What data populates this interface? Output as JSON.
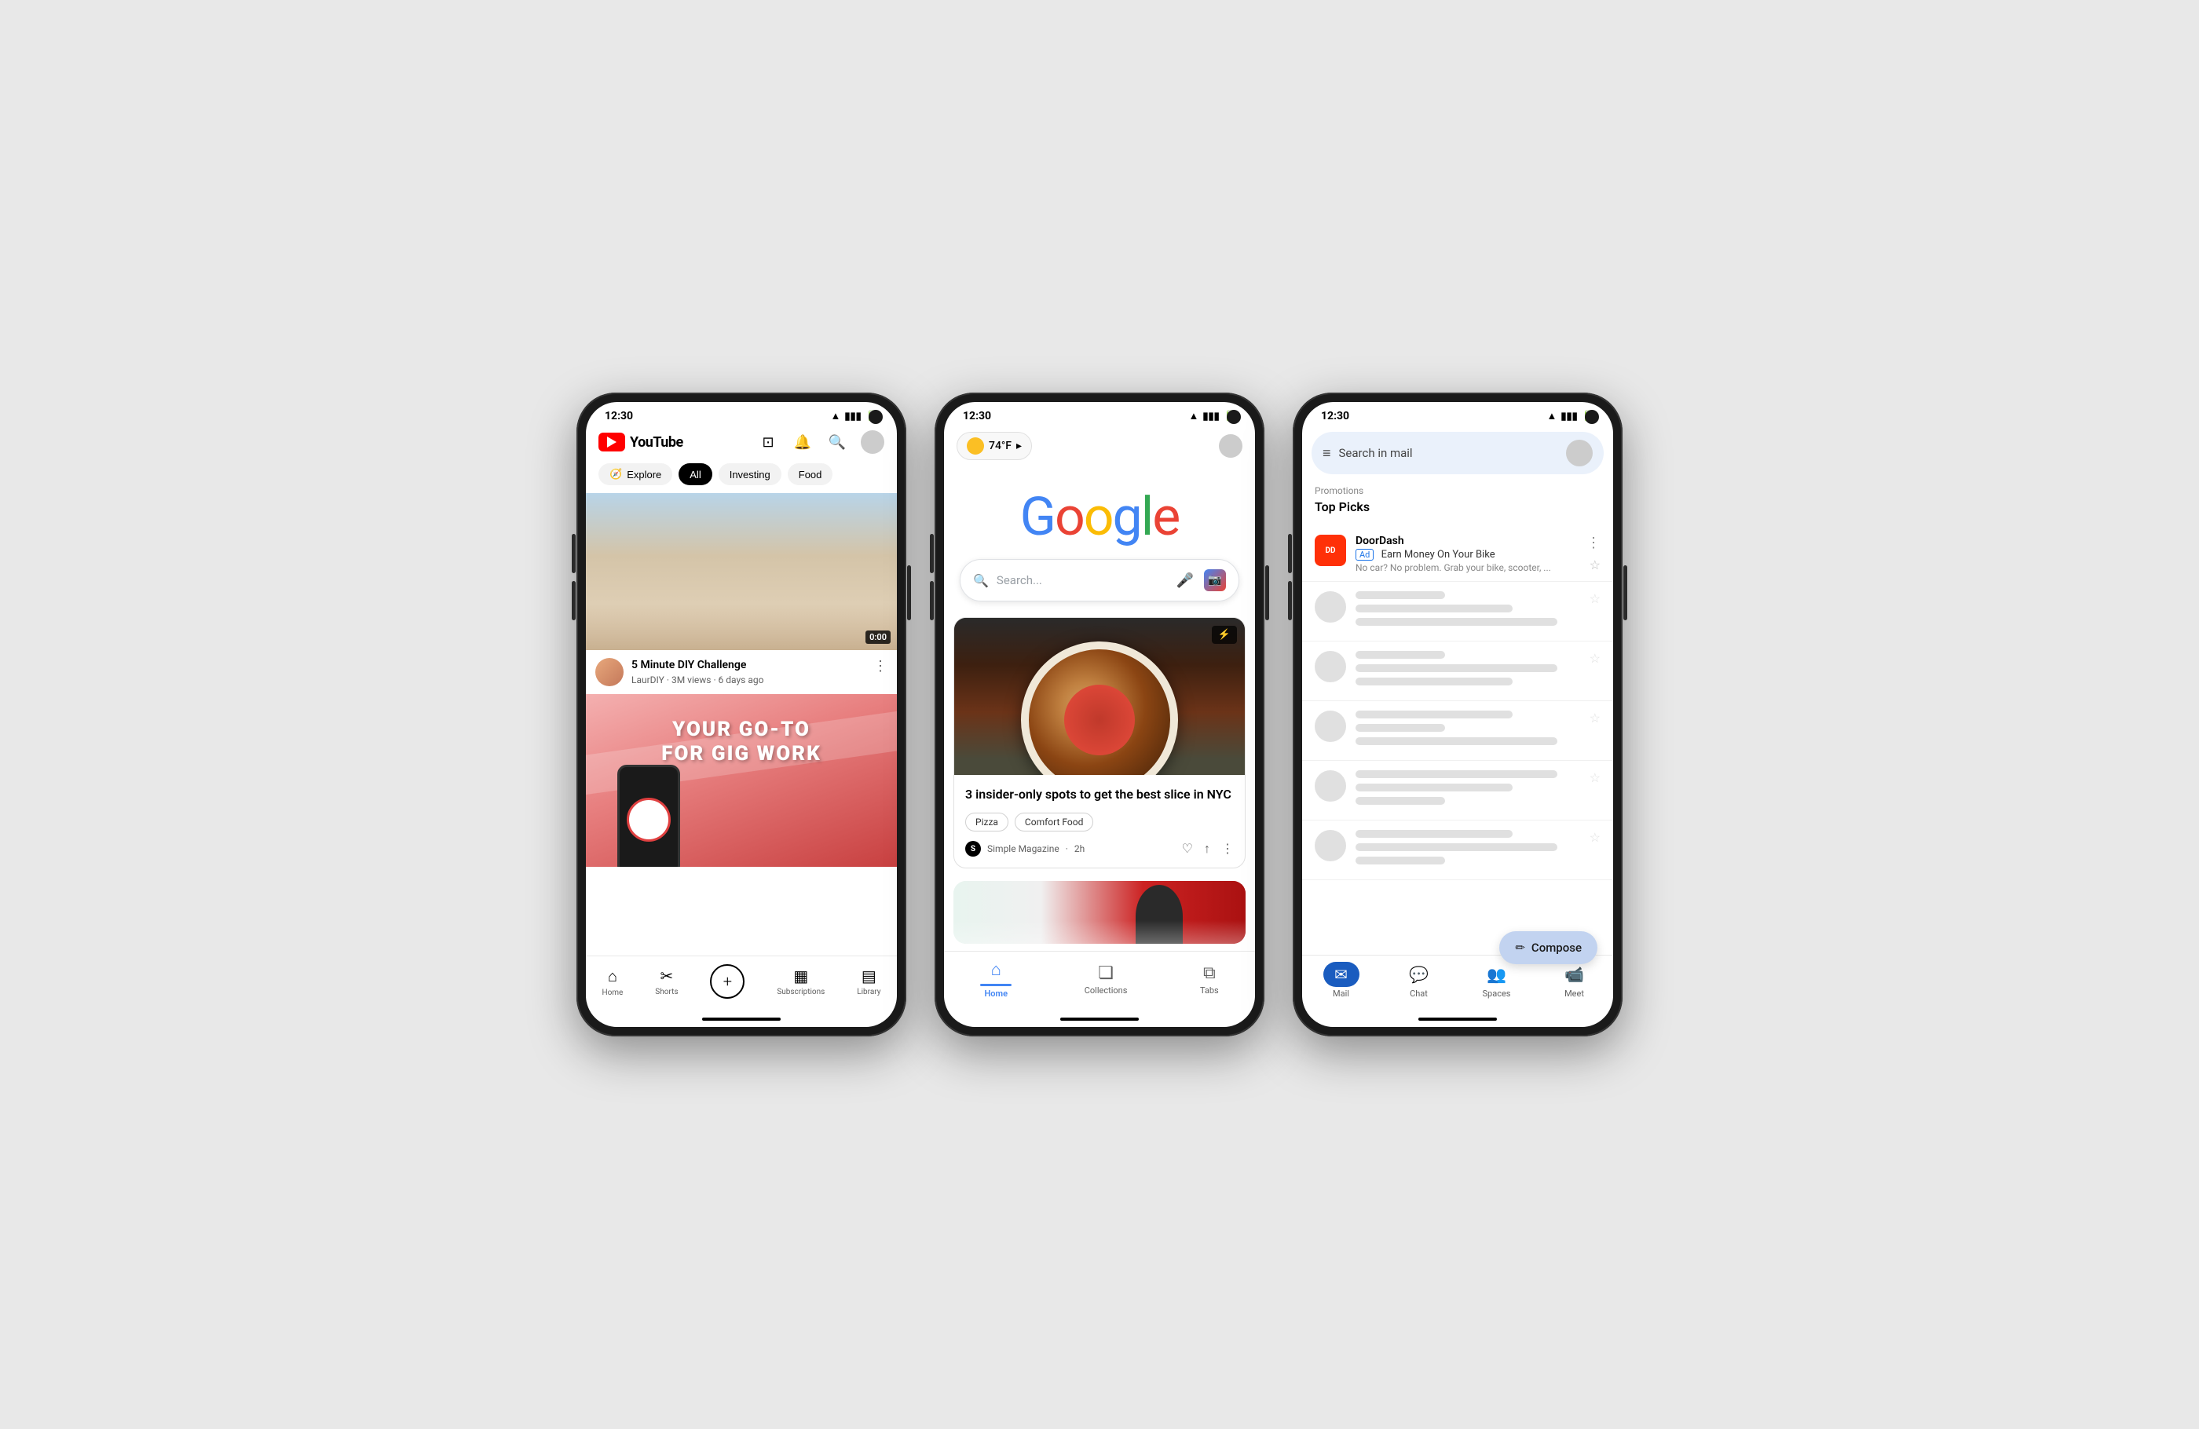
{
  "phone1": {
    "statusBar": {
      "time": "12:30"
    },
    "header": {
      "logoText": "YouTube"
    },
    "chips": [
      {
        "label": "Explore",
        "type": "explore"
      },
      {
        "label": "All",
        "type": "all"
      },
      {
        "label": "Investing",
        "type": "default"
      },
      {
        "label": "Food",
        "type": "default"
      }
    ],
    "video": {
      "title": "5 Minute DIY Challenge",
      "channel": "LaurDIY",
      "meta": "3M views · 6 days ago",
      "duration": "0:00"
    },
    "ad": {
      "line1": "YOUR GO-TO",
      "line2": "FOR GIG WORK"
    },
    "nav": [
      {
        "label": "Home",
        "icon": "⌂"
      },
      {
        "label": "Shorts",
        "icon": "✂"
      },
      {
        "label": "",
        "icon": "+"
      },
      {
        "label": "Subscriptions",
        "icon": "▦"
      },
      {
        "label": "Library",
        "icon": "▤"
      }
    ]
  },
  "phone2": {
    "statusBar": {
      "time": "12:30"
    },
    "weather": {
      "temp": "74°F",
      "arrow": "▸"
    },
    "google": {
      "letters": [
        "G",
        "o",
        "o",
        "g",
        "l",
        "e"
      ],
      "colors": [
        "blue",
        "red",
        "yellow",
        "blue",
        "green",
        "red"
      ],
      "searchPlaceholder": "Search..."
    },
    "article": {
      "title": "3 insider-only spots to get the best slice in NYC",
      "tags": [
        "Pizza",
        "Comfort Food"
      ],
      "source": "Simple Magazine",
      "time": "2h"
    },
    "nav": [
      {
        "label": "Home",
        "active": true
      },
      {
        "label": "Collections",
        "active": false
      },
      {
        "label": "Tabs",
        "active": false
      }
    ]
  },
  "phone3": {
    "statusBar": {
      "time": "12:30"
    },
    "search": {
      "placeholder": "Search in mail"
    },
    "promo": {
      "sectionLabel": "Promotions",
      "topPicksLabel": "Top Picks"
    },
    "doordash": {
      "sender": "DoorDash",
      "adLabel": "Ad",
      "subject": "Earn Money On Your Bike",
      "preview": "No car? No problem. Grab your bike, scooter, ..."
    },
    "compose": {
      "label": "Compose"
    },
    "nav": [
      {
        "label": "Mail",
        "icon": "✉",
        "active": true
      },
      {
        "label": "Chat",
        "icon": "💬",
        "active": false
      },
      {
        "label": "Spaces",
        "icon": "👥",
        "active": false
      },
      {
        "label": "Meet",
        "icon": "📹",
        "active": false
      }
    ]
  },
  "icons": {
    "cast": "⊡",
    "bell": "🔔",
    "search": "🔍",
    "mic": "🎤",
    "more": "⋮",
    "heart": "♡",
    "share": "↑",
    "home": "⌂",
    "hamburger": "≡",
    "pencil": "✏",
    "star": "☆",
    "wifi": "▲",
    "signal": "▮"
  }
}
